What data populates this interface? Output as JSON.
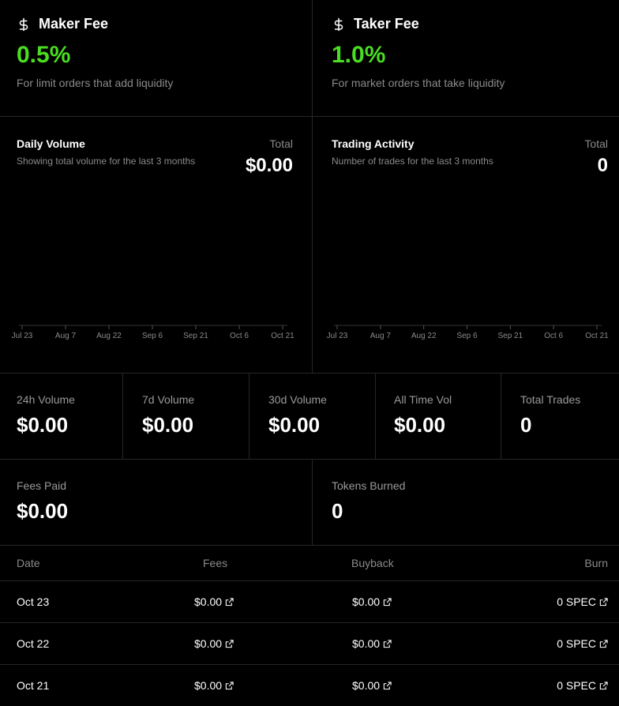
{
  "fees": {
    "maker": {
      "title": "Maker Fee",
      "value": "0.5%",
      "desc": "For limit orders that add liquidity",
      "icon": "dollar-icon"
    },
    "taker": {
      "title": "Taker Fee",
      "value": "1.0%",
      "desc": "For market orders that take liquidity",
      "icon": "dollar-icon"
    }
  },
  "colors": {
    "accent": "#4ade20",
    "border": "#262626",
    "muted": "#8a8a8a"
  },
  "charts": {
    "volume": {
      "title": "Daily Volume",
      "subtitle": "Showing total volume for the last 3 months",
      "total_label": "Total",
      "total_value": "$0.00"
    },
    "activity": {
      "title": "Trading Activity",
      "subtitle": "Number of trades for the last 3 months",
      "total_label": "Total",
      "total_value": "0"
    }
  },
  "chart_data": [
    {
      "type": "bar",
      "title": "Daily Volume",
      "categories": [
        "Jul 23",
        "Aug 7",
        "Aug 22",
        "Sep 6",
        "Sep 21",
        "Oct 6",
        "Oct 21"
      ],
      "values": [
        0,
        0,
        0,
        0,
        0,
        0,
        0
      ],
      "grid": false
    },
    {
      "type": "bar",
      "title": "Trading Activity",
      "categories": [
        "Jul 23",
        "Aug 7",
        "Aug 22",
        "Sep 6",
        "Sep 21",
        "Oct 6",
        "Oct 21"
      ],
      "values": [
        0,
        0,
        0,
        0,
        0,
        0,
        0
      ],
      "grid": false
    }
  ],
  "stats": [
    {
      "label": "24h Volume",
      "value": "$0.00"
    },
    {
      "label": "7d Volume",
      "value": "$0.00"
    },
    {
      "label": "30d Volume",
      "value": "$0.00"
    },
    {
      "label": "All Time Vol",
      "value": "$0.00"
    },
    {
      "label": "Total Trades",
      "value": "0"
    }
  ],
  "summary": {
    "fees_paid": {
      "label": "Fees Paid",
      "value": "$0.00"
    },
    "tokens_burned": {
      "label": "Tokens Burned",
      "value": "0"
    }
  },
  "table": {
    "headers": {
      "date": "Date",
      "fees": "Fees",
      "buyback": "Buyback",
      "burn": "Burn"
    },
    "rows": [
      {
        "date": "Oct 23",
        "fees": "$0.00",
        "buyback": "$0.00",
        "burn": "0 SPEC"
      },
      {
        "date": "Oct 22",
        "fees": "$0.00",
        "buyback": "$0.00",
        "burn": "0 SPEC"
      },
      {
        "date": "Oct 21",
        "fees": "$0.00",
        "buyback": "$0.00",
        "burn": "0 SPEC"
      }
    ]
  }
}
